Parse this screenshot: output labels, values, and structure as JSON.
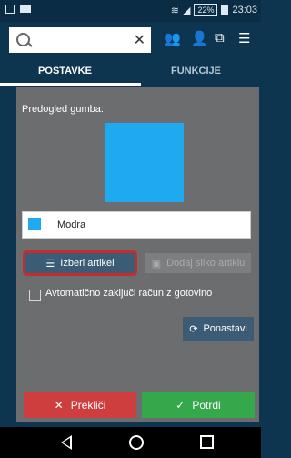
{
  "status": {
    "time": "23:03",
    "battery": "22%"
  },
  "search": {
    "placeholder": ""
  },
  "tabs": [
    {
      "label": "POSTAVKE"
    },
    {
      "label": "FUNKCIJE"
    }
  ],
  "panel": {
    "preview_label": "Predogled gumba:",
    "color_name": "Modra",
    "color_hex": "#1fa9ef",
    "select_item_label": "Izberi artikel",
    "add_image_label": "Dodaj sliko artiklu",
    "auto_close_label": "Avtomatično zaključi račun z gotovino",
    "reset_label": "Ponastavi",
    "cancel_label": "Prekliči",
    "confirm_label": "Potrdi"
  }
}
